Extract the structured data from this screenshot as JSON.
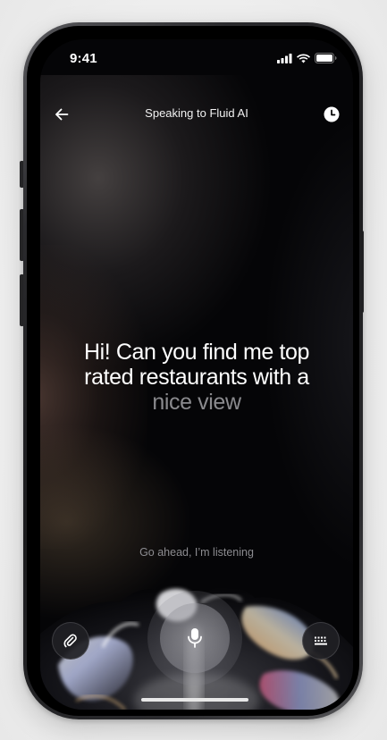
{
  "status_bar": {
    "time": "9:41",
    "signal_icon": "cellular-signal-icon",
    "wifi_icon": "wifi-icon",
    "battery_icon": "battery-icon"
  },
  "header": {
    "title": "Speaking to Fluid AI",
    "back_icon": "arrow-left-icon",
    "history_icon": "clock-icon"
  },
  "transcript": {
    "spoken": "Hi! Can you find me top rated restaurants with a",
    "pending": "nice view"
  },
  "listening_hint": "Go ahead, I’m listening",
  "controls": {
    "attach_icon": "paperclip-icon",
    "mic_icon": "microphone-icon",
    "keyboard_icon": "keyboard-icon"
  },
  "colors": {
    "background": "#050507",
    "text_primary": "#ffffff",
    "text_pending": "#8a8a8e",
    "text_hint": "#8c8c90"
  }
}
